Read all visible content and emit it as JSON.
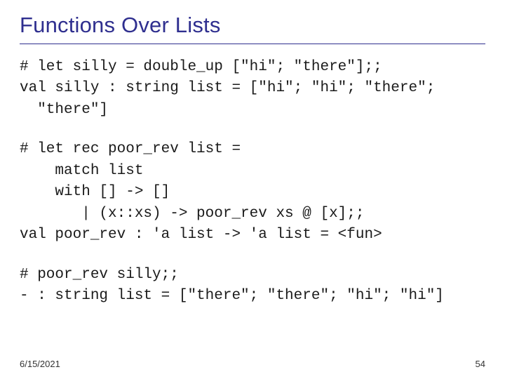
{
  "title": "Functions Over Lists",
  "block1": "# let silly = double_up [\"hi\"; \"there\"];;\nval silly : string list = [\"hi\"; \"hi\"; \"there\";\n  \"there\"]",
  "block2": "# let rec poor_rev list =\n    match list\n    with [] -> []\n       | (x::xs) -> poor_rev xs @ [x];;\nval poor_rev : 'a list -> 'a list = <fun>",
  "block3": "# poor_rev silly;;\n- : string list = [\"there\"; \"there\"; \"hi\"; \"hi\"]",
  "footer": {
    "date": "6/15/2021",
    "page": "54"
  }
}
